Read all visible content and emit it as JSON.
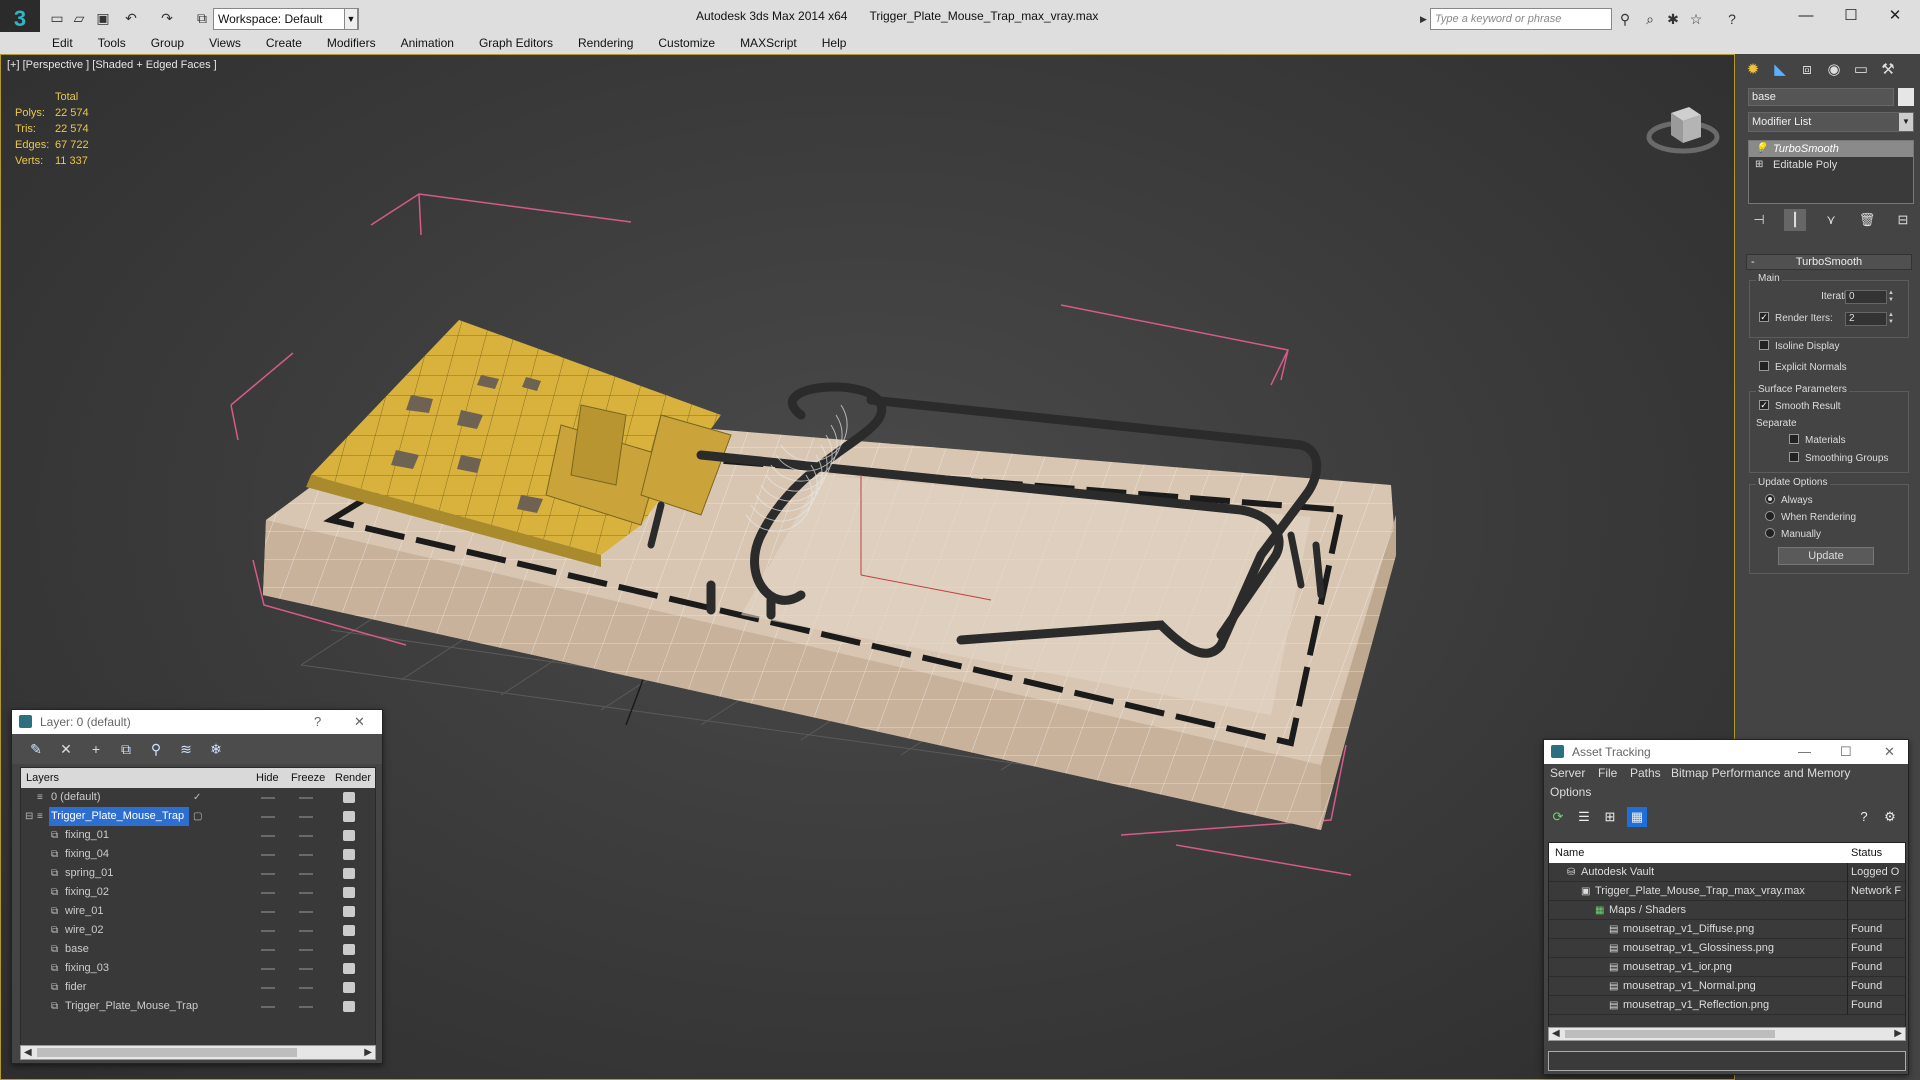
{
  "titlebar": {
    "workspace": "Workspace: Default",
    "app_name": "Autodesk 3ds Max  2014 x64",
    "file_name": "Trigger_Plate_Mouse_Trap_max_vray.max",
    "search_placeholder": "Type a keyword or phrase"
  },
  "menus": [
    "Edit",
    "Tools",
    "Group",
    "Views",
    "Create",
    "Modifiers",
    "Animation",
    "Graph Editors",
    "Rendering",
    "Customize",
    "MAXScript",
    "Help"
  ],
  "viewport": {
    "label": "[+] [Perspective ] [Shaded + Edged Faces ]",
    "stats": {
      "header": "Total",
      "polys_label": "Polys:",
      "polys": "22 574",
      "tris_label": "Tris:",
      "tris": "22 574",
      "edges_label": "Edges:",
      "edges": "67 722",
      "verts_label": "Verts:",
      "verts": "11 337"
    }
  },
  "command_panel": {
    "object_name": "base",
    "modifier_list": "Modifier List",
    "stack": [
      "TurboSmooth",
      "Editable Poly"
    ],
    "rollout_title": "TurboSmooth",
    "main_group": "Main",
    "iterations_label": "Iterations:",
    "iterations_value": "0",
    "render_iters_label": "Render Iters:",
    "render_iters_value": "2",
    "isoline_label": "Isoline Display",
    "explicit_label": "Explicit Normals",
    "surface_group": "Surface Parameters",
    "smooth_result_label": "Smooth Result",
    "separate_label": "Separate",
    "materials_label": "Materials",
    "smoothing_groups_label": "Smoothing Groups",
    "update_group": "Update Options",
    "always_label": "Always",
    "when_rendering_label": "When Rendering",
    "manually_label": "Manually",
    "update_button": "Update"
  },
  "layer_window": {
    "title": "Layer: 0 (default)",
    "help": "?",
    "columns": [
      "Layers",
      "Hide",
      "Freeze",
      "Render"
    ],
    "layers": [
      {
        "name": "0 (default)",
        "level": 1
      },
      {
        "name": "Trigger_Plate_Mouse_Trap",
        "level": 1,
        "selected": true
      },
      {
        "name": "fixing_01",
        "level": 2
      },
      {
        "name": "fixing_04",
        "level": 2
      },
      {
        "name": "spring_01",
        "level": 2
      },
      {
        "name": "fixing_02",
        "level": 2
      },
      {
        "name": "wire_01",
        "level": 2
      },
      {
        "name": "wire_02",
        "level": 2
      },
      {
        "name": "base",
        "level": 2
      },
      {
        "name": "fixing_03",
        "level": 2
      },
      {
        "name": "fider",
        "level": 2
      },
      {
        "name": "Trigger_Plate_Mouse_Trap",
        "level": 2
      }
    ]
  },
  "asset_window": {
    "title": "Asset Tracking",
    "menu_row1": [
      "Server",
      "File",
      "Paths",
      "Bitmap Performance and Memory"
    ],
    "menu_row2": [
      "Options"
    ],
    "columns": [
      "Name",
      "Status"
    ],
    "rows": [
      {
        "name": "Autodesk Vault",
        "status": "Logged O",
        "level": 1
      },
      {
        "name": "Trigger_Plate_Mouse_Trap_max_vray.max",
        "status": "Network F",
        "level": 2
      },
      {
        "name": "Maps / Shaders",
        "status": "",
        "level": 3
      },
      {
        "name": "mousetrap_v1_Diffuse.png",
        "status": "Found",
        "level": 4
      },
      {
        "name": "mousetrap_v1_Glossiness.png",
        "status": "Found",
        "level": 4
      },
      {
        "name": "mousetrap_v1_ior.png",
        "status": "Found",
        "level": 4
      },
      {
        "name": "mousetrap_v1_Normal.png",
        "status": "Found",
        "level": 4
      },
      {
        "name": "mousetrap_v1_Reflection.png",
        "status": "Found",
        "level": 4
      }
    ]
  },
  "colors": {
    "accent_yellow": "#e9c84a",
    "selection_blue": "#2d6fd0",
    "bbox_pink": "#d65a8a",
    "plate_yellow": "#d9b23e",
    "wood": "#d8c6b2"
  }
}
